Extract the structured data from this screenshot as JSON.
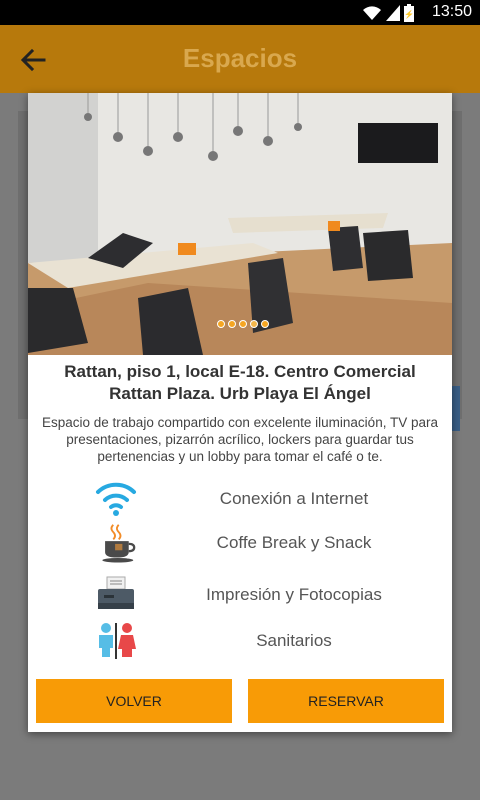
{
  "status_bar": {
    "time": "13:50",
    "icons": [
      "wifi-icon",
      "signal-icon",
      "battery-icon"
    ]
  },
  "app_bar": {
    "title": "Espacios",
    "back_icon": "arrow-left-icon"
  },
  "dialog": {
    "image": {
      "carousel_dots": 5,
      "active_dot": 4
    },
    "title": "Rattan, piso 1, local E-18. Centro Comercial Rattan Plaza. Urb Playa El Ángel",
    "description": "Espacio de trabajo compartido con excelente  iluminación, TV para presentaciones, pizarrón acrílico, lockers para guardar tus pertenencias y un lobby para tomar el café o te.",
    "amenities": [
      {
        "icon": "wifi-icon",
        "label": "Conexión a Internet"
      },
      {
        "icon": "coffee-cup-icon",
        "label": "Coffe Break y Snack"
      },
      {
        "icon": "printer-icon",
        "label": "Impresión y Fotocopias"
      },
      {
        "icon": "restroom-icon",
        "label": "Sanitarios"
      }
    ],
    "buttons": {
      "back": "VOLVER",
      "reserve": "RESERVAR"
    }
  },
  "colors": {
    "app_bar": "#b7790c",
    "accent": "#f89b06",
    "overlay": "#7b7b7b"
  }
}
